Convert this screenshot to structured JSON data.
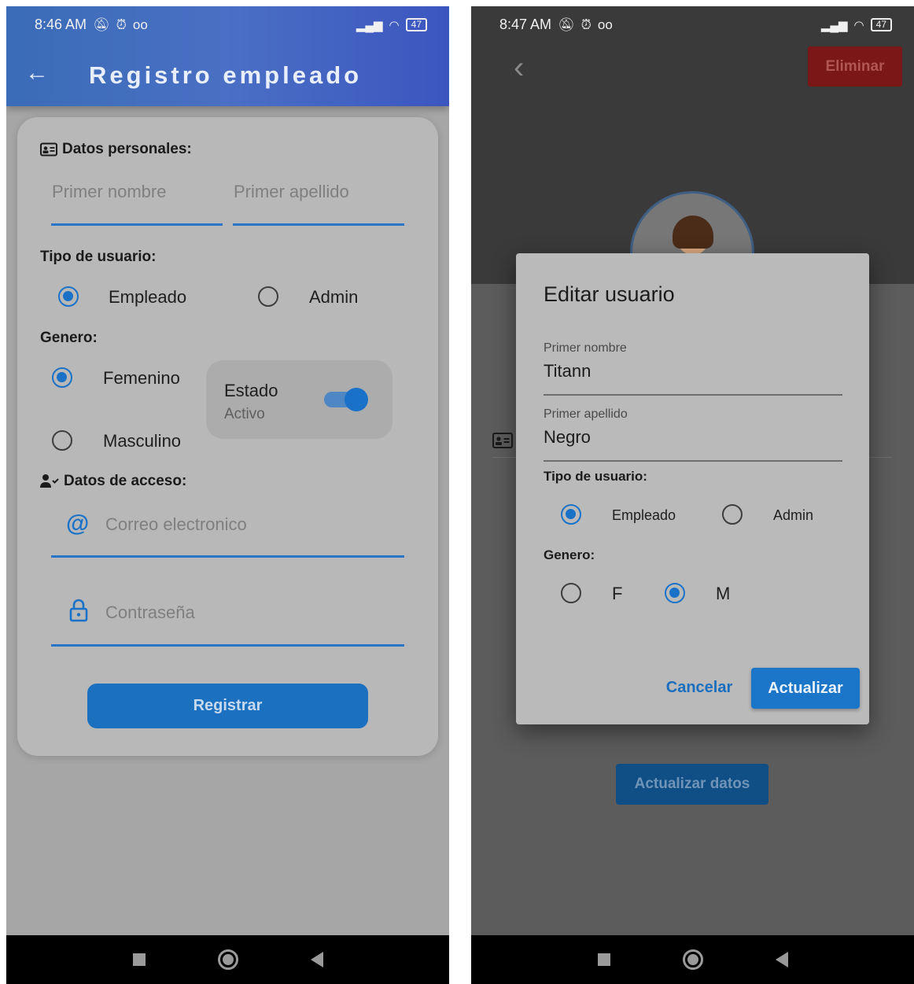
{
  "left": {
    "status": {
      "time": "8:46 AM",
      "battery": "47"
    },
    "appbar": {
      "back_icon": "arrow-left-icon",
      "title": "Registro empleado"
    },
    "datos_personales": {
      "label": "Datos personales:",
      "first_name_placeholder": "Primer nombre",
      "last_name_placeholder": "Primer apellido"
    },
    "tipo_usuario": {
      "label": "Tipo de usuario:",
      "options": [
        "Empleado",
        "Admin"
      ],
      "selected": "Empleado"
    },
    "genero": {
      "label": "Genero:",
      "options": [
        "Femenino",
        "Masculino"
      ],
      "selected": "Femenino"
    },
    "estado": {
      "title": "Estado",
      "subtitle": "Activo",
      "on": true
    },
    "datos_acceso": {
      "label": "Datos de acceso:",
      "email_placeholder": "Correo electronico",
      "password_placeholder": "Contraseña"
    },
    "register_button": "Registrar"
  },
  "right": {
    "status": {
      "time": "8:47 AM",
      "battery": "47"
    },
    "delete_button": "Eliminar",
    "update_data_button": "Actualizar datos",
    "dialog": {
      "title": "Editar usuario",
      "first_name_label": "Primer nombre",
      "first_name_value": "Titann",
      "last_name_label": "Primer apellido",
      "last_name_value": "Negro",
      "tipo_usuario_label": "Tipo de usuario:",
      "tipo_options": [
        "Empleado",
        "Admin"
      ],
      "tipo_selected": "Empleado",
      "genero_label": "Genero:",
      "genero_options": [
        "F",
        "M"
      ],
      "genero_selected": "M",
      "cancel_button": "Cancelar",
      "update_button": "Actualizar"
    }
  },
  "colors": {
    "primary": "#1a72c8",
    "danger": "#7a1818"
  }
}
